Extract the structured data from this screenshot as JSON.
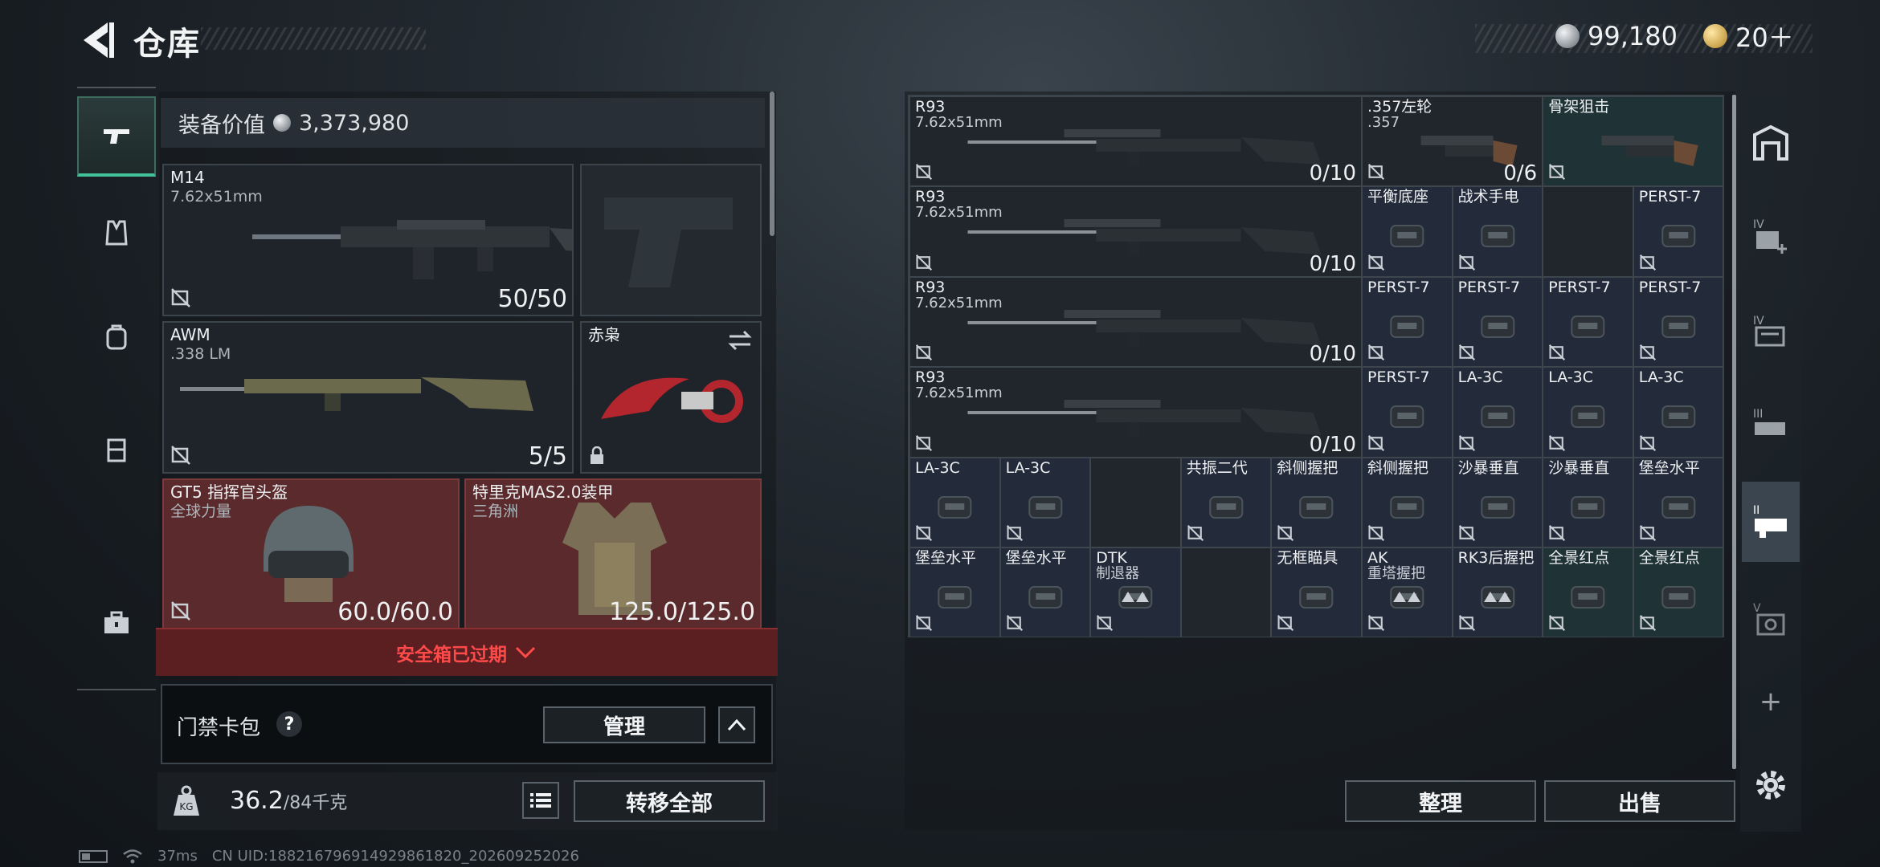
{
  "header": {
    "title": "仓库",
    "currency": [
      {
        "icon": "silver-coin-icon",
        "value": "99,180"
      },
      {
        "icon": "gold-token-icon",
        "value": "20＋"
      }
    ]
  },
  "left_rail": {
    "items": [
      {
        "name": "weapons",
        "icon": "gun-icon",
        "active": true
      },
      {
        "name": "armor",
        "icon": "vest-icon",
        "active": false
      },
      {
        "name": "backpack",
        "icon": "backpack-icon",
        "active": false
      },
      {
        "name": "chest-rig",
        "icon": "rig-icon",
        "active": false
      },
      {
        "name": "case",
        "icon": "briefcase-icon",
        "active": false
      }
    ]
  },
  "equipment": {
    "value_label": "装备价值",
    "value": "3,373,980",
    "slots": [
      {
        "id": "primary",
        "name": "M14",
        "sub": "7.62x51mm",
        "count": "50/50"
      },
      {
        "id": "pistol",
        "name": "",
        "sub": "",
        "count": ""
      },
      {
        "id": "secondary",
        "name": "AWM",
        "sub": ".338 LM",
        "count": "5/5"
      },
      {
        "id": "melee",
        "name": "赤枭",
        "sub": "",
        "count": ""
      },
      {
        "id": "helmet",
        "name": "GT5 指挥官头盔",
        "sub": "全球力量",
        "count": "60.0/60.0"
      },
      {
        "id": "armor",
        "name": "特里克MAS2.0装甲",
        "sub": "三角洲",
        "count": "125.0/125.0"
      }
    ],
    "safe_box_status": "安全箱已过期",
    "keycard_label": "门禁卡包",
    "help_label": "?",
    "manage_label": "管理",
    "weight_current": "36.2",
    "weight_max": "/84千克",
    "transfer_all_label": "转移全部"
  },
  "warehouse": {
    "rows": [
      [
        {
          "name": "R93",
          "sub": "7.62x51mm",
          "count": "0/10",
          "span": 5
        },
        {
          "name": ".357左轮",
          "sub": ".357",
          "count": "0/6",
          "span": 2
        },
        {
          "name": "骨架狙击",
          "sub": "",
          "count": "",
          "span": 2,
          "tone": "teal"
        }
      ],
      [
        {
          "name": "R93",
          "sub": "7.62x51mm",
          "count": "0/10",
          "span": 5
        },
        {
          "name": "平衡底座",
          "sub": "",
          "count": "",
          "span": 1
        },
        {
          "name": "战术手电",
          "sub": "",
          "count": "",
          "span": 1
        },
        {
          "name": "",
          "sub": "",
          "count": "",
          "span": 1
        },
        {
          "name": "PERST-7",
          "sub": "",
          "count": "",
          "span": 1
        }
      ],
      [
        {
          "name": "R93",
          "sub": "7.62x51mm",
          "count": "0/10",
          "span": 5
        },
        {
          "name": "PERST-7",
          "sub": "",
          "count": "",
          "span": 1
        },
        {
          "name": "PERST-7",
          "sub": "",
          "count": "",
          "span": 1
        },
        {
          "name": "PERST-7",
          "sub": "",
          "count": "",
          "span": 1
        },
        {
          "name": "PERST-7",
          "sub": "",
          "count": "",
          "span": 1
        }
      ],
      [
        {
          "name": "R93",
          "sub": "7.62x51mm",
          "count": "0/10",
          "span": 5
        },
        {
          "name": "PERST-7",
          "sub": "",
          "count": "",
          "span": 1
        },
        {
          "name": "LA-3C",
          "sub": "",
          "count": "",
          "span": 1
        },
        {
          "name": "LA-3C",
          "sub": "",
          "count": "",
          "span": 1
        },
        {
          "name": "LA-3C",
          "sub": "",
          "count": "",
          "span": 1
        }
      ],
      [
        {
          "name": "LA-3C",
          "sub": "",
          "count": "",
          "span": 1
        },
        {
          "name": "LA-3C",
          "sub": "",
          "count": "",
          "span": 1
        },
        {
          "name": "",
          "sub": "",
          "count": "",
          "span": 1
        },
        {
          "name": "共振二代",
          "sub": "",
          "count": "",
          "span": 1
        },
        {
          "name": "斜侧握把",
          "sub": "",
          "count": "",
          "span": 1
        },
        {
          "name": "斜侧握把",
          "sub": "",
          "count": "",
          "span": 1
        },
        {
          "name": "沙暴垂直",
          "sub": "",
          "count": "",
          "span": 1
        },
        {
          "name": "沙暴垂直",
          "sub": "",
          "count": "",
          "span": 1
        },
        {
          "name": "堡垒水平",
          "sub": "",
          "count": "",
          "span": 1
        }
      ],
      [
        {
          "name": "堡垒水平",
          "sub": "",
          "count": "",
          "span": 1
        },
        {
          "name": "堡垒水平",
          "sub": "",
          "count": "",
          "span": 1
        },
        {
          "name": "DTK",
          "sub": "制退器",
          "count": "",
          "span": 1
        },
        {
          "name": "",
          "sub": "",
          "count": "",
          "span": 1
        },
        {
          "name": "无框瞄具",
          "sub": "",
          "count": "",
          "span": 1
        },
        {
          "name": "AK",
          "sub": "重塔握把",
          "count": "",
          "span": 1
        },
        {
          "name": "RK3后握把",
          "sub": "",
          "count": "",
          "span": 1
        },
        {
          "name": "全景红点",
          "sub": "",
          "count": "",
          "span": 1,
          "tone": "teal"
        },
        {
          "name": "全景红点",
          "sub": "",
          "count": "",
          "span": 1,
          "tone": "teal"
        }
      ]
    ],
    "sort_label": "整理",
    "sell_label": "出售"
  },
  "right_rail": {
    "items": [
      {
        "name": "storage",
        "icon": "storage-icon"
      },
      {
        "name": "page-iv-add",
        "icon": "page-iv-add-icon"
      },
      {
        "name": "page-iv",
        "icon": "page-iv-icon"
      },
      {
        "name": "page-iii",
        "icon": "page-iii-icon"
      },
      {
        "name": "page-ii",
        "icon": "page-ii-icon",
        "active": true
      },
      {
        "name": "page-v",
        "icon": "page-v-icon"
      }
    ],
    "add_label": "+"
  },
  "status_bar": {
    "ping": "37ms",
    "uid": "CN UID:18821679691492986182​0_202609252026"
  }
}
